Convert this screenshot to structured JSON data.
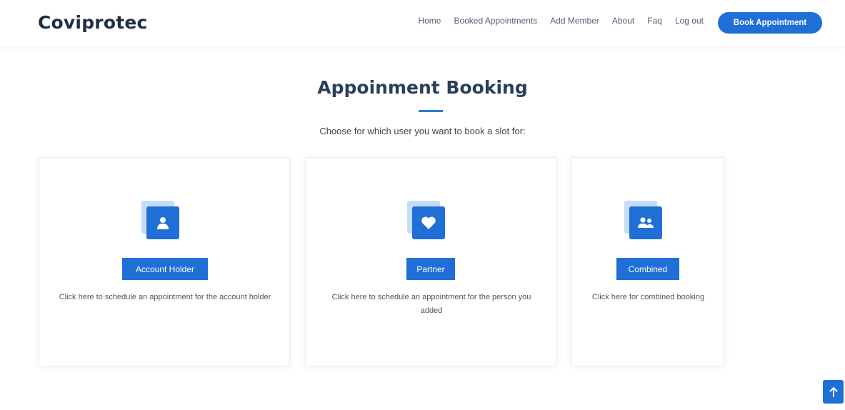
{
  "header": {
    "logo": "Coviprotec",
    "nav": [
      "Home",
      "Booked Appointments",
      "Add Member",
      "About",
      "Faq",
      "Log out"
    ],
    "cta_label": "Book Appointment"
  },
  "main": {
    "title": "Appoinment Booking",
    "subtitle": "Choose for which user you want to book a slot for:",
    "cards": [
      {
        "icon": "user-icon",
        "button": "Account Holder",
        "description": "Click here to schedule an appointment for the account holder"
      },
      {
        "icon": "heart-icon",
        "button": "Partner",
        "description": "Click here to schedule an appointment for the person you added"
      },
      {
        "icon": "users-icon",
        "button": "Combined",
        "description": "Click here for combined booking"
      }
    ]
  },
  "back_to_top_icon": "arrow-up-icon",
  "colors": {
    "primary": "#1f6fd6",
    "icon_back": "#c4dcf8",
    "title": "#2b3e5a",
    "logo": "#1f2f47"
  }
}
